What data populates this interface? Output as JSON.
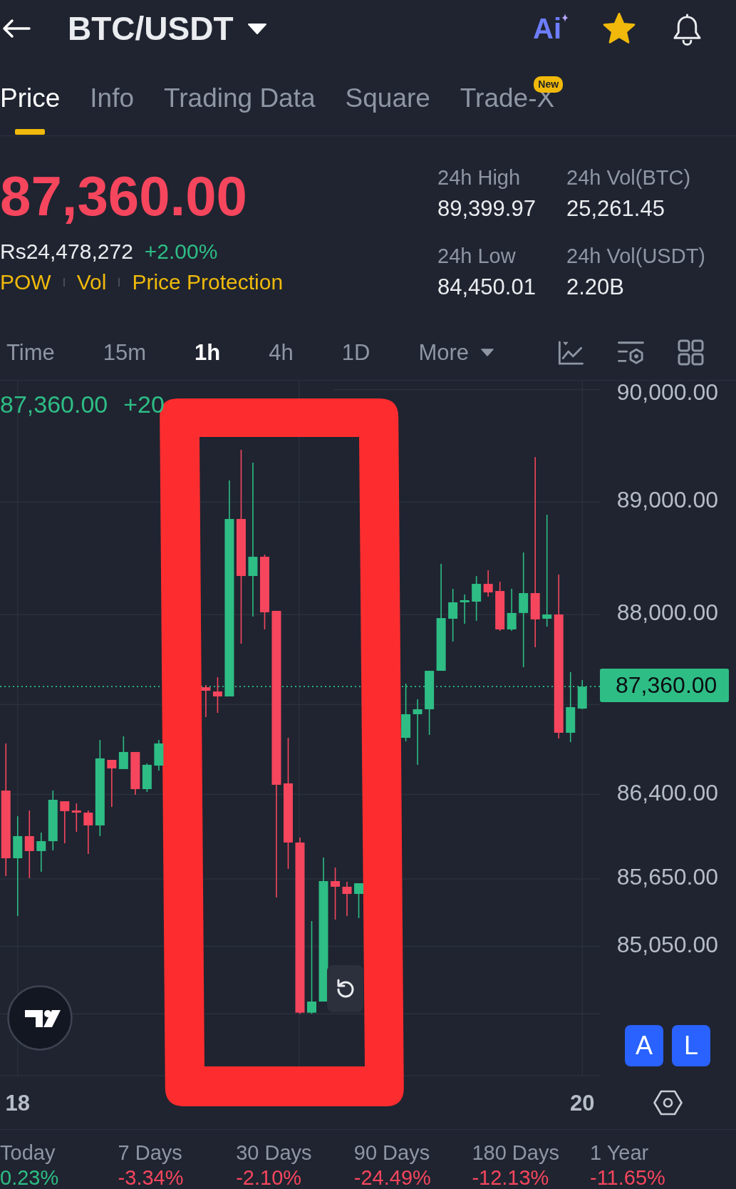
{
  "header": {
    "title": "BTC/USDT",
    "ai_label": "Ai",
    "favorite": true
  },
  "tabs": [
    {
      "label": "Price",
      "selected": true
    },
    {
      "label": "Info",
      "selected": false
    },
    {
      "label": "Trading Data",
      "selected": false
    },
    {
      "label": "Square",
      "selected": false
    },
    {
      "label": "Trade-X",
      "selected": false,
      "badge": "New"
    }
  ],
  "ticker": {
    "last_price": "87,360.00",
    "last_price_up": false,
    "fiat_price": "Rs24,478,272",
    "change": "+2.00%",
    "change_up": true,
    "tags": [
      "POW",
      "Vol",
      "Price Protection"
    ],
    "stats": [
      {
        "label": "24h High",
        "value": "89,399.97"
      },
      {
        "label": "24h Vol(BTC)",
        "value": "25,261.45"
      },
      {
        "label": "24h Low",
        "value": "84,450.01"
      },
      {
        "label": "24h Vol(USDT)",
        "value": "2.20B"
      }
    ]
  },
  "intervals": [
    {
      "label": "Time",
      "kind": "interval",
      "selected": false
    },
    {
      "label": "15m",
      "kind": "interval",
      "selected": false
    },
    {
      "label": "1h",
      "kind": "interval",
      "selected": true
    },
    {
      "label": "4h",
      "kind": "interval",
      "selected": false
    },
    {
      "label": "1D",
      "kind": "interval",
      "selected": false
    },
    {
      "label": "More",
      "kind": "menu",
      "selected": false
    }
  ],
  "chart": {
    "price": "87,360.00",
    "change": "+20",
    "change_up": true,
    "buttons": [
      "A",
      "L"
    ],
    "chart_data": {
      "type": "candlestick",
      "grid": true,
      "categories": [
        null,
        "18",
        null,
        null,
        null,
        null,
        null,
        null,
        null,
        null,
        null,
        null,
        null,
        null,
        null,
        null,
        null,
        null,
        null,
        null,
        null,
        null,
        null,
        null,
        null,
        null,
        null,
        null,
        null,
        null,
        null,
        null,
        null,
        null,
        null,
        null,
        null,
        null,
        null,
        null,
        null,
        null,
        null,
        null,
        null,
        null,
        null,
        null,
        null,
        "20"
      ],
      "ohlc": [
        [
          86435,
          86854,
          85675,
          85833
        ],
        [
          85833,
          86207,
          85320,
          86030
        ],
        [
          86030,
          86258,
          85656,
          85897
        ],
        [
          85897,
          86061,
          85713,
          85985
        ],
        [
          85985,
          86435,
          85903,
          86353
        ],
        [
          86340,
          86340,
          85966,
          86252
        ],
        [
          86258,
          86321,
          86068,
          86239
        ],
        [
          86239,
          86258,
          85871,
          86125
        ],
        [
          86125,
          86885,
          86030,
          86721
        ],
        [
          86708,
          86708,
          86290,
          86632
        ],
        [
          86626,
          86917,
          86626,
          86778
        ],
        [
          86778,
          86778,
          86397,
          86448
        ],
        [
          86448,
          86676,
          86423,
          86664
        ],
        [
          86657,
          86885,
          86613,
          86854
        ],
        null,
        null,
        null,
        [
          87354,
          87373,
          87088,
          87323
        ],
        [
          87316,
          87443,
          87126,
          87272
        ],
        [
          87272,
          89193,
          87272,
          88850
        ],
        [
          88850,
          89465,
          87741,
          88343
        ],
        [
          88343,
          89351,
          87982,
          88514
        ],
        [
          88514,
          88533,
          87868,
          88020
        ],
        [
          88033,
          88033,
          85485,
          86486
        ],
        [
          86499,
          86904,
          85738,
          85973
        ],
        [
          85973,
          86017,
          84450,
          84460
        ],
        [
          84460,
          85275,
          84450,
          84559
        ],
        [
          84559,
          85840,
          84559,
          85630
        ],
        [
          85630,
          85751,
          85288,
          85580
        ],
        [
          85580,
          85624,
          85320,
          85516
        ],
        [
          85516,
          85611,
          85301,
          85611
        ],
        null,
        null,
        null,
        [
          86904,
          87386,
          86873,
          87114
        ],
        [
          87114,
          87247,
          86664,
          87158
        ],
        [
          87158,
          87500,
          86930,
          87500
        ],
        [
          87500,
          88451,
          87500,
          87969
        ],
        [
          87963,
          88229,
          87760,
          88109
        ],
        [
          88109,
          88178,
          87919,
          88128
        ],
        [
          88115,
          88343,
          87944,
          88273
        ],
        [
          88273,
          88394,
          88159,
          88197
        ],
        [
          88210,
          88292,
          87855,
          87868
        ],
        [
          87868,
          88229,
          87855,
          88014
        ],
        [
          88014,
          88552,
          87532,
          88191
        ],
        [
          88191,
          89400,
          87709,
          87957
        ],
        [
          87963,
          88888,
          87893,
          88001
        ],
        [
          88001,
          88356,
          86898,
          86949
        ],
        [
          86949,
          87488,
          86866,
          87177
        ],
        [
          87164,
          87418,
          87158,
          87360
        ]
      ],
      "ylim": [
        83900,
        90080
      ],
      "yticks": [
        {
          "value": 90000,
          "label": "90,000.00"
        },
        {
          "value": 89000,
          "label": "89,000.00"
        },
        {
          "value": 88000,
          "label": "88,000.00"
        },
        {
          "value": 86400,
          "label": "86,400.00"
        },
        {
          "value": 85650,
          "label": "85,650.00"
        },
        {
          "value": 85050,
          "label": "85,050.00"
        }
      ],
      "ref_lines": [
        {
          "axis": "y",
          "value": 87360,
          "label": "87,360.00",
          "color": "#2ebd85"
        }
      ]
    }
  },
  "performance": [
    {
      "period": "Today",
      "change": "0.23%",
      "up": true
    },
    {
      "period": "7 Days",
      "change": "-3.34%",
      "up": false
    },
    {
      "period": "30 Days",
      "change": "-2.10%",
      "up": false
    },
    {
      "period": "90 Days",
      "change": "-24.49%",
      "up": false
    },
    {
      "period": "180 Days",
      "change": "-12.13%",
      "up": false
    },
    {
      "period": "1 Year",
      "change": "-11.65%",
      "up": false
    }
  ]
}
